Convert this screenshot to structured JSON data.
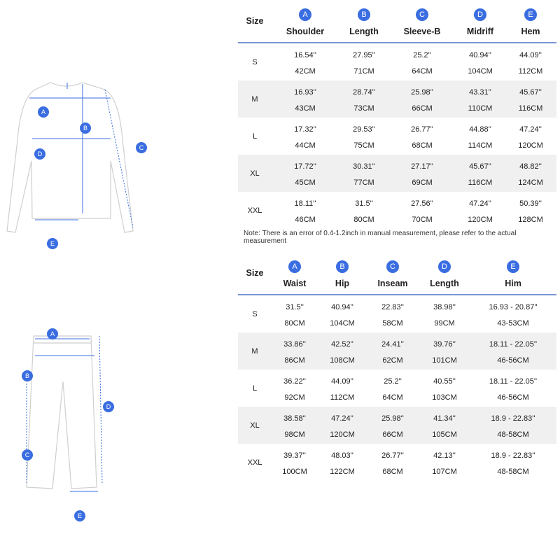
{
  "top_table": {
    "size_header": "Size",
    "columns": [
      {
        "badge": "A",
        "label": "Shoulder"
      },
      {
        "badge": "B",
        "label": "Length"
      },
      {
        "badge": "C",
        "label": "Sleeve-B"
      },
      {
        "badge": "D",
        "label": "Midriff"
      },
      {
        "badge": "E",
        "label": "Hem"
      }
    ],
    "rows": [
      {
        "size": "S",
        "inch": [
          "16.54''",
          "27.95''",
          "25.2''",
          "40.94''",
          "44.09''"
        ],
        "cm": [
          "42CM",
          "71CM",
          "64CM",
          "104CM",
          "112CM"
        ]
      },
      {
        "size": "M",
        "inch": [
          "16.93''",
          "28.74''",
          "25.98''",
          "43.31''",
          "45.67''"
        ],
        "cm": [
          "43CM",
          "73CM",
          "66CM",
          "110CM",
          "116CM"
        ]
      },
      {
        "size": "L",
        "inch": [
          "17.32''",
          "29.53''",
          "26.77''",
          "44.88''",
          "47.24''"
        ],
        "cm": [
          "44CM",
          "75CM",
          "68CM",
          "114CM",
          "120CM"
        ]
      },
      {
        "size": "XL",
        "inch": [
          "17.72''",
          "30.31''",
          "27.17''",
          "45.67''",
          "48.82''"
        ],
        "cm": [
          "45CM",
          "77CM",
          "69CM",
          "116CM",
          "124CM"
        ]
      },
      {
        "size": "XXL",
        "inch": [
          "18.11''",
          "31.5''",
          "27.56''",
          "47.24''",
          "50.39''"
        ],
        "cm": [
          "46CM",
          "80CM",
          "70CM",
          "120CM",
          "128CM"
        ]
      }
    ],
    "note": "Note: There is an error of 0.4-1.2inch in manual measurement, please refer to the actual measurement"
  },
  "bottom_table": {
    "size_header": "Size",
    "columns": [
      {
        "badge": "A",
        "label": "Waist"
      },
      {
        "badge": "B",
        "label": "Hip"
      },
      {
        "badge": "C",
        "label": "Inseam"
      },
      {
        "badge": "D",
        "label": "Length"
      },
      {
        "badge": "E",
        "label": "Him"
      }
    ],
    "rows": [
      {
        "size": "S",
        "inch": [
          "31.5''",
          "40.94''",
          "22.83''",
          "38.98''",
          "16.93 - 20.87''"
        ],
        "cm": [
          "80CM",
          "104CM",
          "58CM",
          "99CM",
          "43-53CM"
        ]
      },
      {
        "size": "M",
        "inch": [
          "33.86''",
          "42.52''",
          "24.41''",
          "39.76''",
          "18.11 - 22.05''"
        ],
        "cm": [
          "86CM",
          "108CM",
          "62CM",
          "101CM",
          "46-56CM"
        ]
      },
      {
        "size": "L",
        "inch": [
          "36.22''",
          "44.09''",
          "25.2''",
          "40.55''",
          "18.11 - 22.05''"
        ],
        "cm": [
          "92CM",
          "112CM",
          "64CM",
          "103CM",
          "46-56CM"
        ]
      },
      {
        "size": "XL",
        "inch": [
          "38.58''",
          "47.24''",
          "25.98''",
          "41.34''",
          "18.9 - 22.83''"
        ],
        "cm": [
          "98CM",
          "120CM",
          "66CM",
          "105CM",
          "48-58CM"
        ]
      },
      {
        "size": "XXL",
        "inch": [
          "39.37''",
          "48.03''",
          "26.77''",
          "42.13''",
          "18.9 - 22.83''"
        ],
        "cm": [
          "100CM",
          "122CM",
          "68CM",
          "107CM",
          "48-58CM"
        ]
      }
    ]
  },
  "diagram_labels": {
    "sweater": [
      "A",
      "B",
      "C",
      "D",
      "E"
    ],
    "pants": [
      "A",
      "B",
      "C",
      "D",
      "E"
    ]
  },
  "colors": {
    "accent": "#3a6de0",
    "alt_row": "#f0f0f0"
  }
}
